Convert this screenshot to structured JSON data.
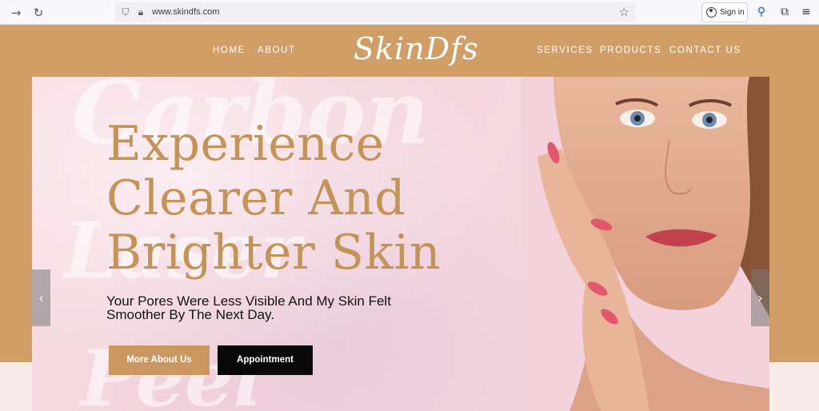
{
  "browser": {
    "url": "www.skindfs.com",
    "signin_label": "Sign in",
    "icons": [
      "back-arrow-icon",
      "reload-icon",
      "shield-icon",
      "lock-icon",
      "star-icon",
      "account-icon",
      "search-icon",
      "extensions-icon",
      "menu-icon"
    ]
  },
  "nav": {
    "left": [
      "HOME",
      "ABOUT"
    ],
    "right": [
      "SERVICES",
      "PRODUCTS",
      "CONTACT US"
    ],
    "logo": "SkinDfs"
  },
  "hero": {
    "headline_lines": [
      "Experience",
      "Clearer And",
      "Brighter Skin"
    ],
    "subline": "Your Pores Were Less Visible And My Skin Felt Smoother By The Next Day.",
    "primary_button": "More About Us",
    "secondary_button": "Appointment",
    "background_script": [
      "Carbon",
      "Laser",
      "Peel"
    ],
    "prev_arrow": "‹",
    "next_arrow": "›"
  },
  "colors": {
    "brand_tan": "#d19e67",
    "headline_gold": "#c49358",
    "button_gold": "#c9975f",
    "button_dark": "#0a0a0a",
    "hero_pink": "#f5d7e0"
  }
}
